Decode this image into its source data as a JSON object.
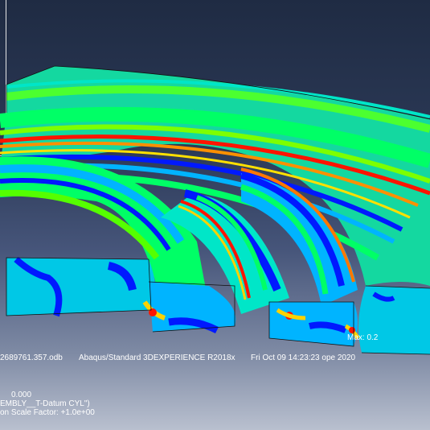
{
  "viewport": {
    "background_top": "#1f2b43",
    "background_bottom": "#b9c0cf",
    "contour_palette": [
      "#0019ff",
      "#0066ff",
      "#00b4ff",
      "#00e6c8",
      "#00ff66",
      "#55ff00",
      "#c8ff00",
      "#ffd200",
      "#ff7800",
      "#ff1400"
    ]
  },
  "annotation": {
    "max_label": "Max: 0.2"
  },
  "status_line": {
    "odb_file": "2689761.357.odb",
    "solver": "Abaqus/Standard 3DEXPERIENCE R2018x",
    "timestamp": "Fri Oct 09 14:23:23 ope 2020"
  },
  "info_block": {
    "line1": "0.000",
    "line2": "EMBLY__T-Datum CYL\")",
    "line3": "on Scale Factor: +1.0e+00"
  }
}
